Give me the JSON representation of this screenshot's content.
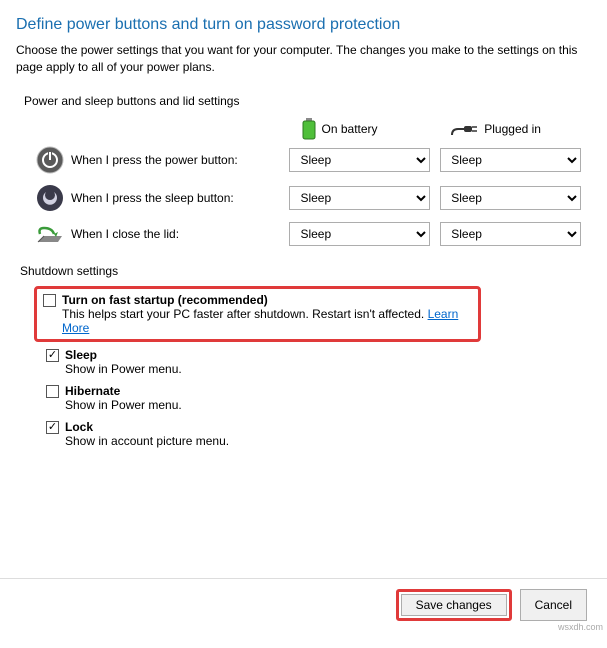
{
  "heading": "Define power buttons and turn on password protection",
  "description": "Choose the power settings that you want for your computer. The changes you make to the settings on this page apply to all of your power plans.",
  "section_label": "Power and sleep buttons and lid settings",
  "columns": {
    "battery": "On battery",
    "plugged": "Plugged in"
  },
  "rows": {
    "power_button": {
      "label": "When I press the power button:",
      "battery": "Sleep",
      "plugged": "Sleep"
    },
    "sleep_button": {
      "label": "When I press the sleep button:",
      "battery": "Sleep",
      "plugged": "Sleep"
    },
    "lid": {
      "label": "When I close the lid:",
      "battery": "Sleep",
      "plugged": "Sleep"
    }
  },
  "shutdown_label": "Shutdown settings",
  "shutdown": {
    "fast_startup": {
      "title": "Turn on fast startup (recommended)",
      "sub": "This helps start your PC faster after shutdown. Restart isn't affected.",
      "link": "Learn More",
      "checked": false
    },
    "sleep": {
      "title": "Sleep",
      "sub": "Show in Power menu.",
      "checked": true
    },
    "hibernate": {
      "title": "Hibernate",
      "sub": "Show in Power menu.",
      "checked": false
    },
    "lock": {
      "title": "Lock",
      "sub": "Show in account picture menu.",
      "checked": true
    }
  },
  "buttons": {
    "save": "Save changes",
    "cancel": "Cancel"
  },
  "watermark": "wsxdh.com"
}
